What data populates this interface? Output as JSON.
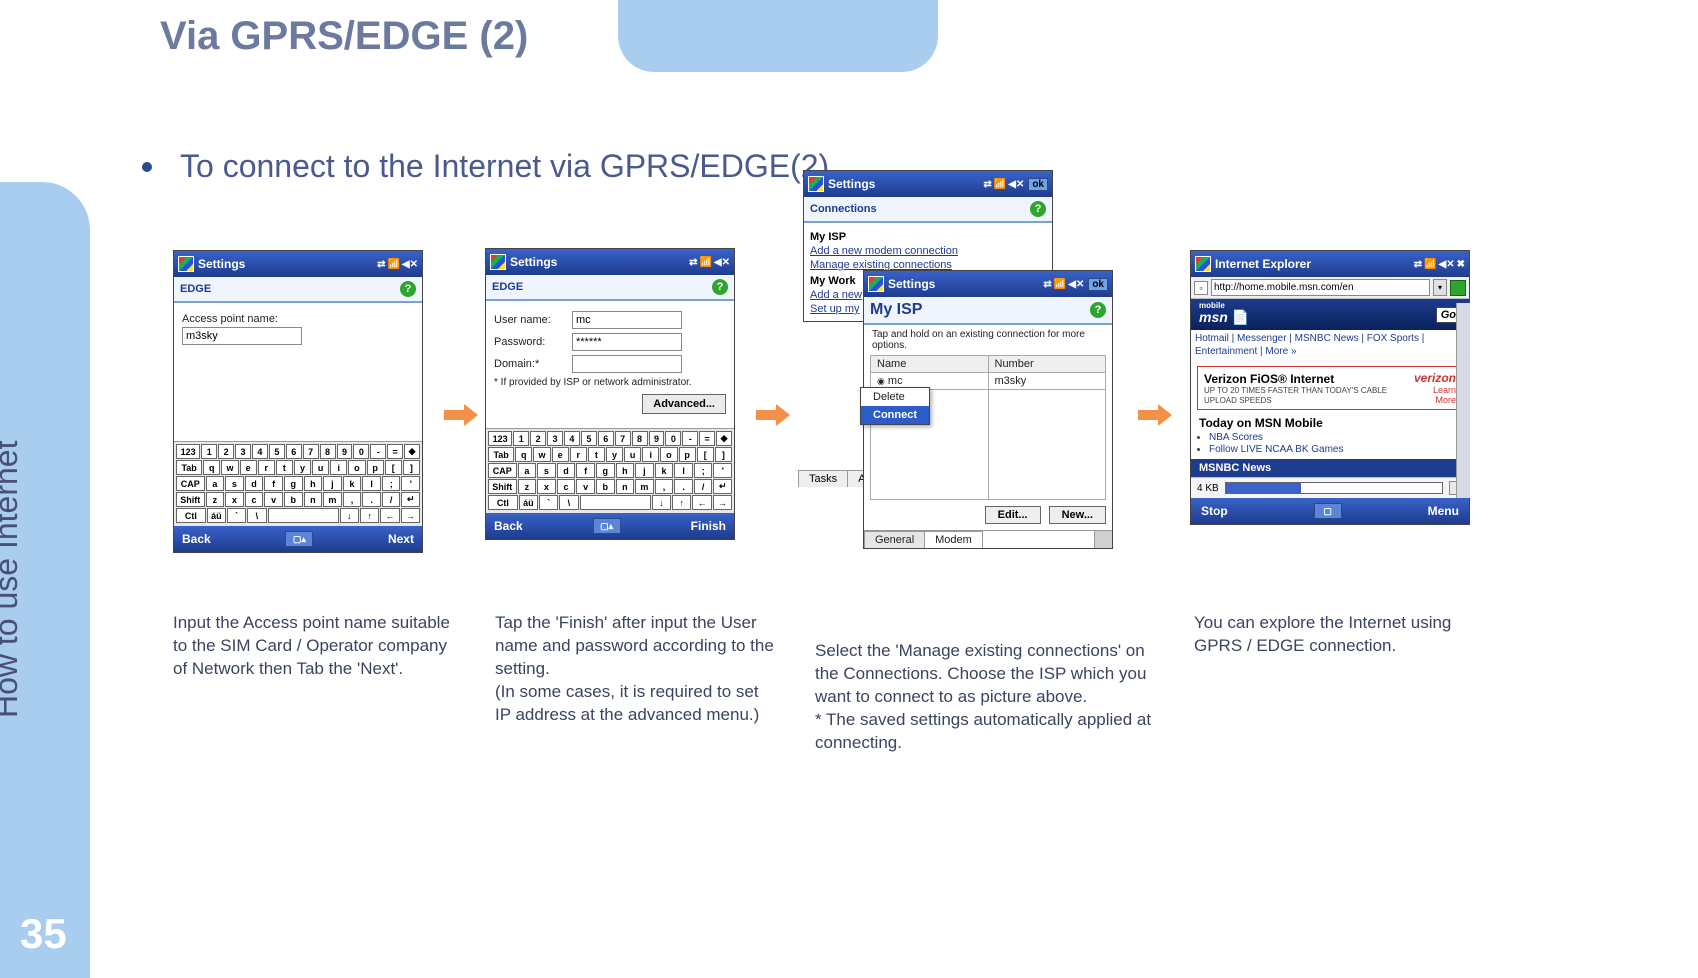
{
  "page": {
    "title": "Via GPRS/EDGE (2)",
    "sidebar_label": "How to use Internet",
    "number": "35",
    "bullet": "To connect to the Internet via GPRS/EDGE(2)"
  },
  "panel1": {
    "title": "Settings",
    "subhead": "EDGE",
    "field_label": "Access point name:",
    "field_value": "m3sky",
    "back": "Back",
    "next": "Next"
  },
  "panel2": {
    "title": "Settings",
    "subhead": "EDGE",
    "user_label": "User name:",
    "user_value": "mc",
    "pass_label": "Password:",
    "pass_value": "******",
    "domain_label": "Domain:*",
    "domain_value": "",
    "note": "* If provided by ISP or network administrator.",
    "advanced": "Advanced...",
    "back": "Back",
    "finish": "Finish"
  },
  "osk": {
    "row1": [
      "123",
      "1",
      "2",
      "3",
      "4",
      "5",
      "6",
      "7",
      "8",
      "9",
      "0",
      "-",
      "=",
      "◆"
    ],
    "row2": [
      "Tab",
      "q",
      "w",
      "e",
      "r",
      "t",
      "y",
      "u",
      "i",
      "o",
      "p",
      "[",
      "]"
    ],
    "row3": [
      "CAP",
      "a",
      "s",
      "d",
      "f",
      "g",
      "h",
      "j",
      "k",
      "l",
      ";",
      "'"
    ],
    "row4": [
      "Shift",
      "z",
      "x",
      "c",
      "v",
      "b",
      "n",
      "m",
      ",",
      ".",
      "/",
      "↵"
    ],
    "row5": [
      "Ctl",
      "áü",
      "`",
      "\\",
      " ",
      "↓",
      "↑",
      "←",
      "→"
    ]
  },
  "panel3": {
    "outer_title": "Settings",
    "outer_sub": "Connections",
    "ok": "ok",
    "myisp_label": "My ISP",
    "link_add_modem": "Add a new modem connection",
    "link_manage": "Manage existing connections",
    "mywork_label": "My Work",
    "link_add_new": "Add a new",
    "link_setup": "Set up my",
    "inner_title": "Settings",
    "inner_sub": "My ISP",
    "instr": "Tap and hold on an existing connection for more options.",
    "col_name": "Name",
    "col_number": "Number",
    "row_number": "m3sky",
    "ctx_delete": "Delete",
    "ctx_connect": "Connect",
    "edit": "Edit...",
    "newbtn": "New...",
    "tab_general": "General",
    "tab_modem": "Modem",
    "tasks": "Tasks",
    "adv": "Adv"
  },
  "panel4": {
    "title": "Internet Explorer",
    "url": "http://home.mobile.msn.com/en",
    "msn_label": "msn",
    "msn_prefix": "mobile",
    "go": "Go",
    "links": "Hotmail | Messenger | MSNBC News | FOX Sports | Entertainment | More »",
    "vz_name": "Verizon FiOS® Internet",
    "vz_sub": "UP TO 20 TIMES FASTER THAN TODAY'S CABLE UPLOAD SPEEDS",
    "vz_logo": "verizon",
    "vz_learn": "Learn More",
    "today": "Today on MSN Mobile",
    "list1": "NBA Scores",
    "list2": "Follow LIVE NCAA BK Games",
    "msnbc": "MSNBC News",
    "dl_size": "4 KB",
    "stop": "Stop",
    "menu": "Menu"
  },
  "captions": {
    "c1": "Input the Access point name suitable to the SIM Card / Operator company of Network then Tab the  'Next'.",
    "c2": "Tap the 'Finish' after input the User name and password according to the setting.\n(In some cases, it is required to set IP address at the advanced menu.)",
    "c3": "Select the 'Manage existing connections' on the Connections. Choose the ISP which you want to connect to as picture above.\n * The saved settings automatically applied  at connecting.",
    "c4": "You can explore the Internet using GPRS / EDGE connection."
  }
}
